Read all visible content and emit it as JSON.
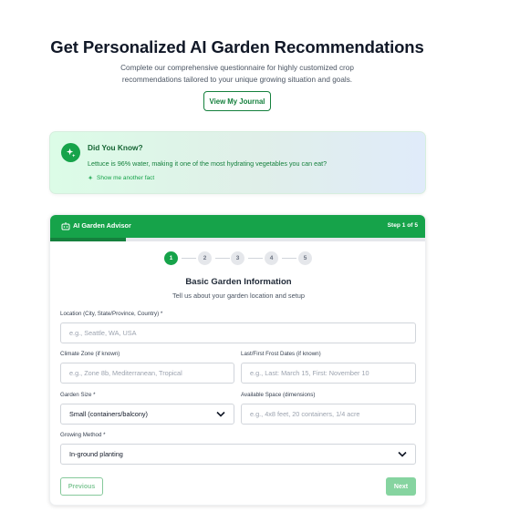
{
  "hero": {
    "title": "Get Personalized AI Garden Recommendations",
    "subtitle_line1": "Complete our comprehensive questionnaire for highly customized crop",
    "subtitle_line2": "recommendations tailored to your unique growing situation and goals.",
    "journal_button": "View My Journal"
  },
  "fact": {
    "title": "Did You Know?",
    "text": "Lettuce is 96% water, making it one of the most hydrating vegetables you can eat?",
    "more_link": "Show me another fact",
    "icon": "sparkle-icon"
  },
  "advisor": {
    "title": "AI Garden Advisor",
    "step_label": "Step 1 of 5",
    "progress": 0.2,
    "steps": [
      "1",
      "2",
      "3",
      "4",
      "5"
    ],
    "active_step": 1,
    "section_title": "Basic Garden Information",
    "section_subtitle": "Tell us about your garden location and setup"
  },
  "form": {
    "location": {
      "label": "Location (City, State/Province, Country) *",
      "placeholder": "e.g., Seattle, WA, USA"
    },
    "climate": {
      "label": "Climate Zone (if known)",
      "placeholder": "e.g., Zone 8b, Mediterranean, Tropical"
    },
    "frost": {
      "label": "Last/First Frost Dates (if known)",
      "placeholder": "e.g., Last: March 15, First: November 10"
    },
    "garden_size": {
      "label": "Garden Size *",
      "value": "Small (containers/balcony)"
    },
    "space": {
      "label": "Available Space (dimensions)",
      "placeholder": "e.g., 4x8 feet, 20 containers, 1/4 acre"
    },
    "method": {
      "label": "Growing Method *",
      "value": "In-ground planting"
    }
  },
  "nav": {
    "previous": "Previous",
    "next": "Next"
  },
  "colors": {
    "accent": "#16a34a",
    "accent_dark": "#15803d",
    "disabled_green": "#86d4a0"
  }
}
